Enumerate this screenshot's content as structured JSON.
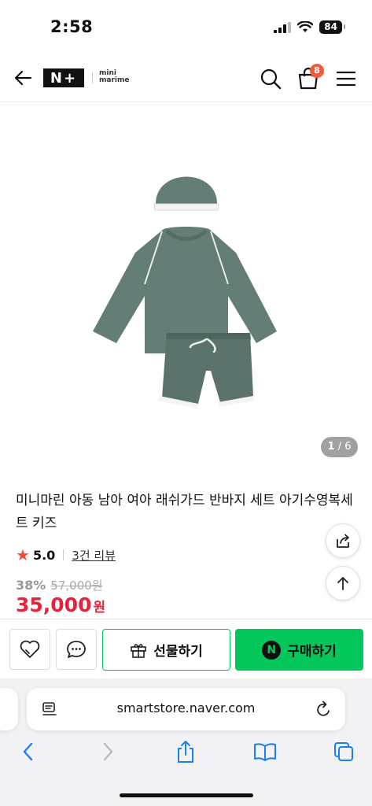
{
  "status_bar": {
    "time": "2:58",
    "battery": "84"
  },
  "header": {
    "store_badge": "N+",
    "brand_line1": "mini",
    "brand_line2": "marime",
    "cart_count": "8"
  },
  "gallery": {
    "current": "1",
    "total": "/ 6"
  },
  "product": {
    "title": "미니마린 아동 남아 여아 래쉬가드 반바지 세트 아기수영복세트 키즈",
    "rating": "5.0",
    "review_link": "3건 리뷰",
    "discount": "38%",
    "original_price": "57,000원",
    "price": "35,000",
    "currency": "원"
  },
  "buy_bar": {
    "gift_label": "선물하기",
    "buy_label": "구매하기",
    "buy_icon_letter": "N"
  },
  "browser": {
    "url": "smartstore.naver.com"
  },
  "colors": {
    "accent_green": "#03c75a",
    "price_red": "#e8223a",
    "star": "#f04d37",
    "badge": "#f25a3c",
    "garment": "#647d76"
  }
}
